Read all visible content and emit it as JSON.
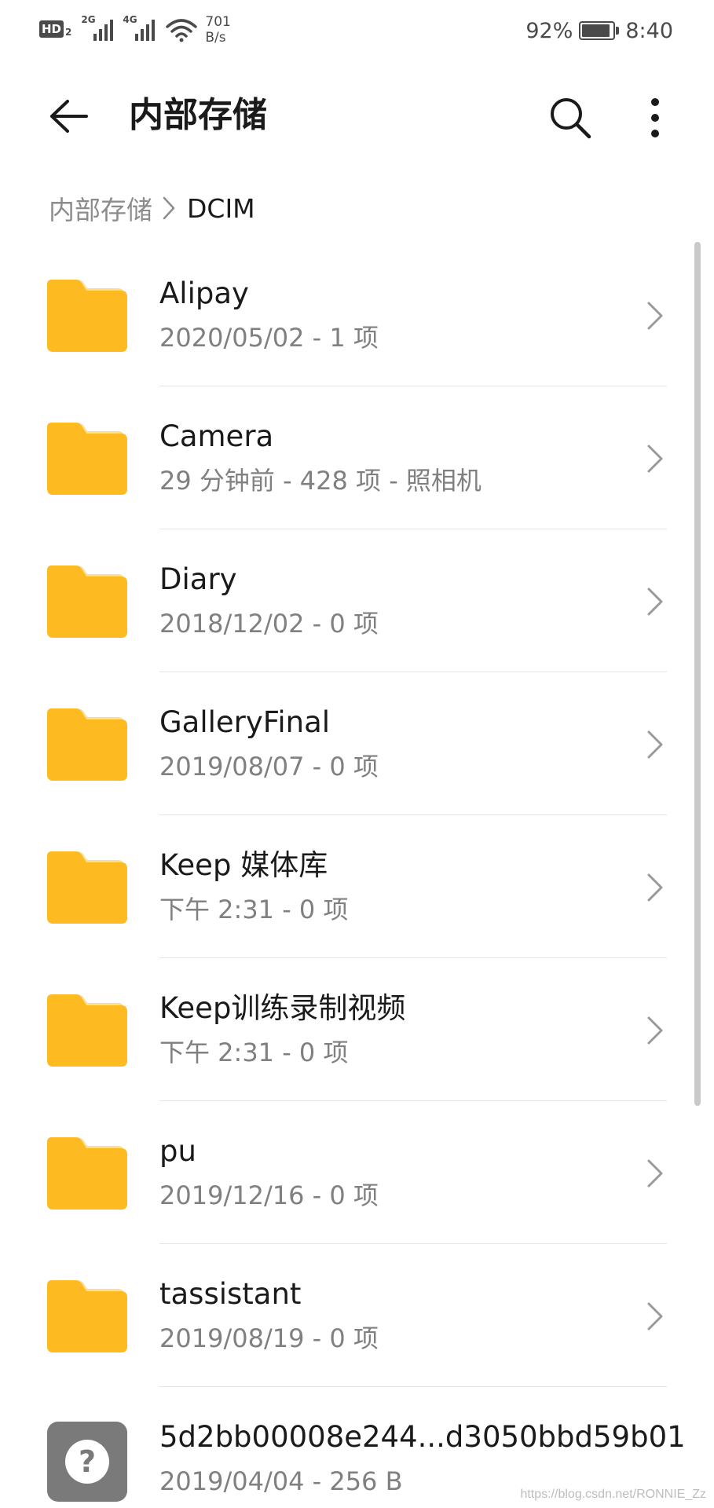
{
  "status_bar": {
    "hd_label": "HD",
    "hd_sub": "2",
    "network_1": "2G",
    "network_2": "4G",
    "net_speed_value": "701",
    "net_speed_unit": "B/s",
    "battery_percent": "92%",
    "battery_level": 0.92,
    "time": "8:40",
    "icons": [
      "signal-icon",
      "wifi-icon",
      "battery-icon"
    ]
  },
  "app_bar": {
    "title": "内部存储",
    "icons": [
      "back-arrow-icon",
      "search-icon",
      "more-vert-icon"
    ]
  },
  "breadcrumb": {
    "root": "内部存储",
    "current": "DCIM"
  },
  "colors": {
    "folder": "#FDBA21",
    "folder_tab": "#FDDE8F",
    "unknown_file": "#7A7A7A"
  },
  "items": [
    {
      "name": "Alipay",
      "meta": "2020/05/02 - 1 项",
      "type": "folder"
    },
    {
      "name": "Camera",
      "meta": "29 分钟前 - 428 项 - 照相机",
      "type": "folder"
    },
    {
      "name": "Diary",
      "meta": "2018/12/02 - 0 项",
      "type": "folder"
    },
    {
      "name": "GalleryFinal",
      "meta": "2019/08/07 - 0 项",
      "type": "folder"
    },
    {
      "name": "Keep 媒体库",
      "meta": "下午 2:31  - 0 项",
      "type": "folder"
    },
    {
      "name": "Keep训练录制视频",
      "meta": "下午 2:31  - 0 项",
      "type": "folder"
    },
    {
      "name": "pu",
      "meta": "2019/12/16 - 0 项",
      "type": "folder"
    },
    {
      "name": "tassistant",
      "meta": "2019/08/19 - 0 项",
      "type": "folder"
    },
    {
      "name": "5d2bb00008e244...d3050bbd59b01",
      "meta": "2019/04/04 - 256 B",
      "type": "unknown-file",
      "icon_glyph": "?"
    }
  ],
  "watermark": "https://blog.csdn.net/RONNIE_Zz"
}
